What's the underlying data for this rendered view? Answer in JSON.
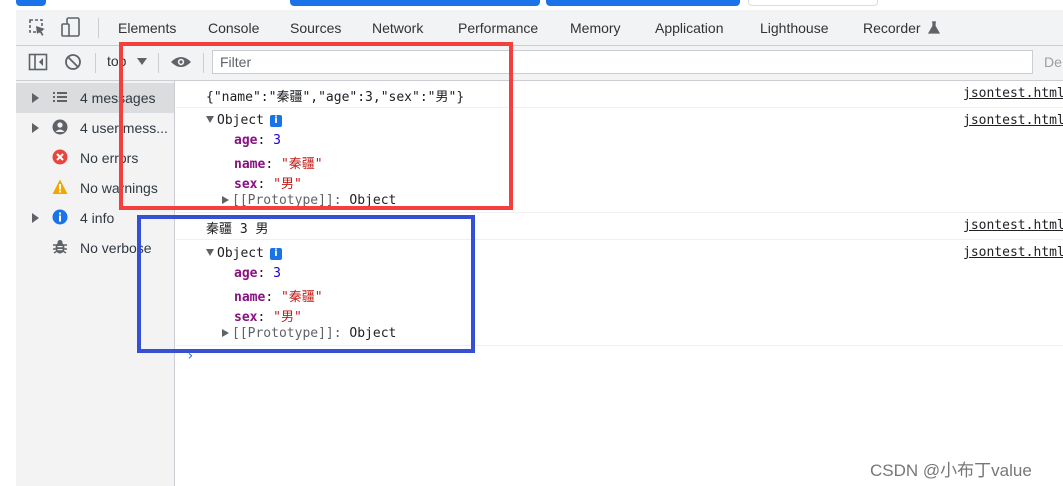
{
  "tabs": [
    "Elements",
    "Console",
    "Sources",
    "Network",
    "Performance",
    "Memory",
    "Application",
    "Lighthouse",
    "Recorder"
  ],
  "toolbar": {
    "context": "top",
    "filter_placeholder": "Filter",
    "default_levels": "De"
  },
  "sidebar": {
    "items": [
      {
        "label": "4 messages",
        "icon": "list-icon",
        "expandable": true,
        "selected": true
      },
      {
        "label": "4 user mess...",
        "icon": "user-icon",
        "expandable": true,
        "selected": false
      },
      {
        "label": "No errors",
        "icon": "error-icon",
        "expandable": false,
        "selected": false
      },
      {
        "label": "No warnings",
        "icon": "warning-icon",
        "expandable": false,
        "selected": false
      },
      {
        "label": "4 info",
        "icon": "info-icon",
        "expandable": true,
        "selected": false
      },
      {
        "label": "No verbose",
        "icon": "bug-icon",
        "expandable": false,
        "selected": false
      }
    ]
  },
  "console": {
    "line1": "{\"name\":\"秦疆\",\"age\":3,\"sex\":\"男\"}",
    "line3": "秦疆 3 男",
    "source": "jsontest.html",
    "object": {
      "label": "Object",
      "info_badge": "i",
      "age_key": "age",
      "age_val": "3",
      "name_key": "name",
      "name_val": "\"秦疆\"",
      "sex_key": "sex",
      "sex_val": "\"男\"",
      "proto_key": "[[Prototype]]",
      "proto_val": "Object"
    },
    "prompt": "›"
  },
  "watermark": "CSDN @小布丁value",
  "colors": {
    "red_box": "#f43f3f",
    "blue_box": "#3550d6",
    "accent": "#1a73e8"
  }
}
